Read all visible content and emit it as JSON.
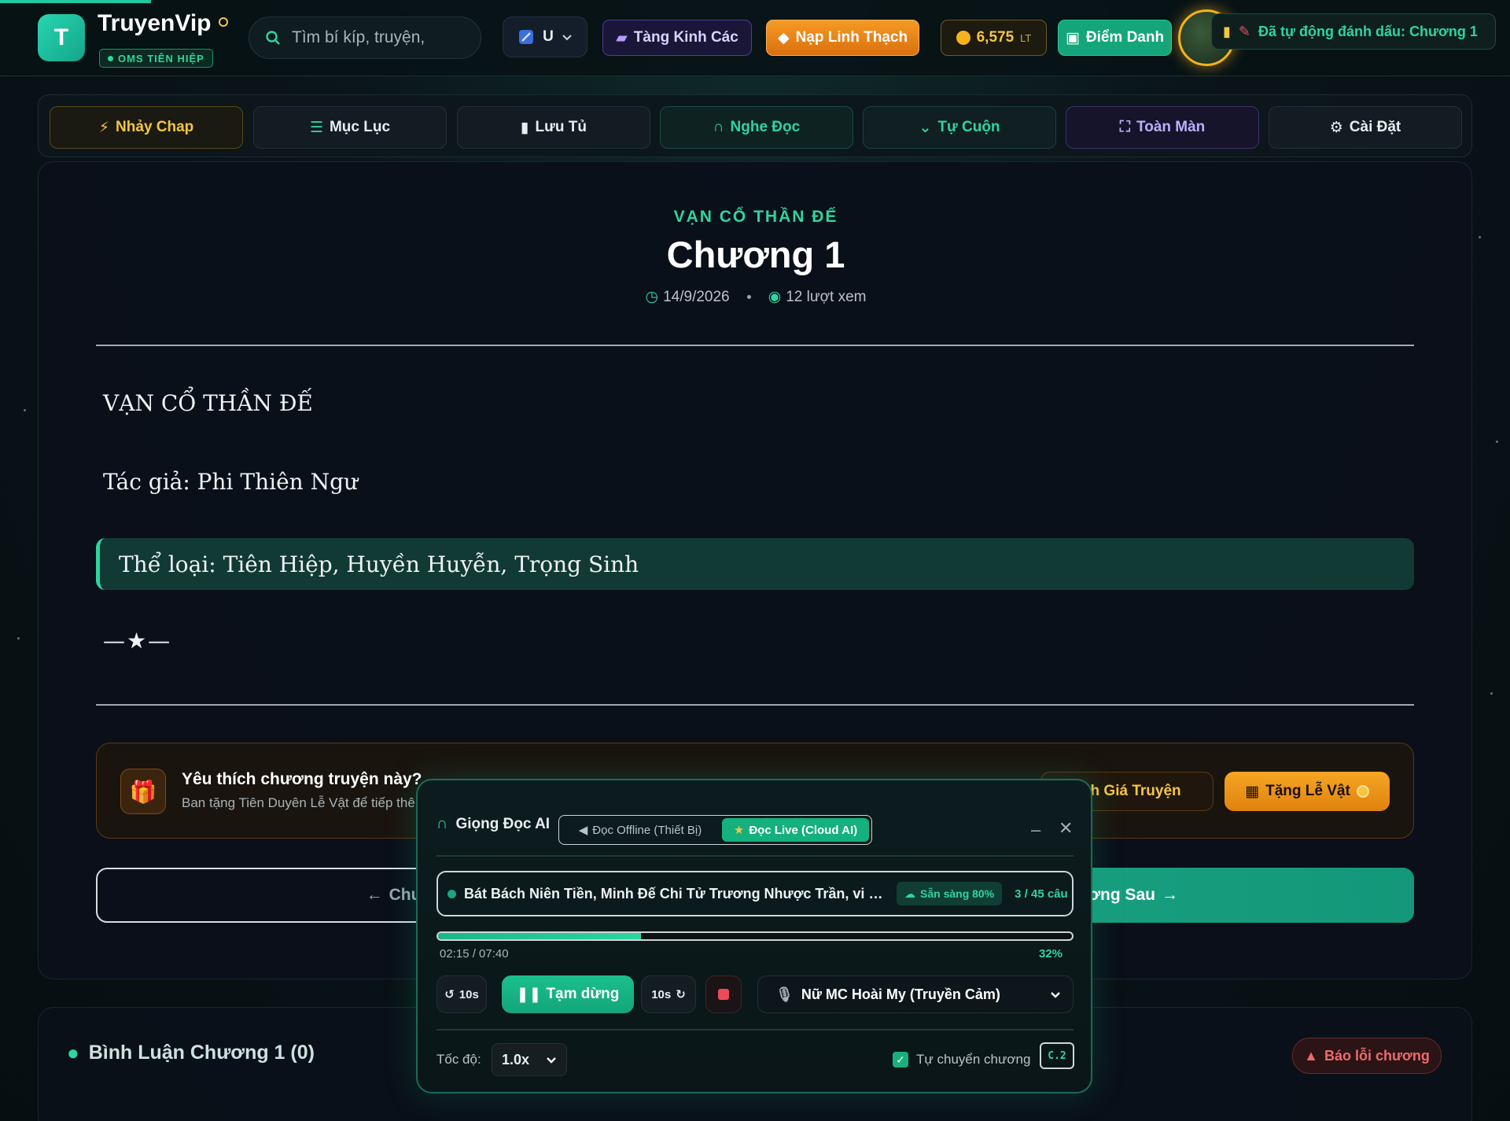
{
  "header": {
    "logo_letter": "T",
    "brand": "TruyenVip",
    "brand_badge": "OMS TIÊN HIỆP",
    "search_placeholder": "Tìm bí kíp, truyện,",
    "user_initial": "U",
    "btn_kinh": "Tàng Kinh Các",
    "btn_nap": "Nạp Linh Thạch",
    "coin_value": "6,575",
    "coin_unit": "LT",
    "btn_diem": "Điểm Danh",
    "toast": "Đã tự động đánh dấu: Chương 1"
  },
  "nav": {
    "jump": "Nhảy Chap",
    "toc": "Mục Lục",
    "save": "Lưu Tủ",
    "listen": "Nghe Đọc",
    "autoscroll": "Tự Cuộn",
    "fullscreen": "Toàn Màn",
    "settings": "Cài Đặt"
  },
  "chapter": {
    "story": "VẠN CỔ THẦN ĐẾ",
    "title": "Chương 1",
    "date": "14/9/2026",
    "views": "12 lượt xem",
    "line1": "VẠN CỔ THẦN ĐẾ",
    "line2": "Tác giả: Phi Thiên Ngư",
    "genre": "Thể loại: Tiên Hiệp, Huyền Huyễn, Trọng Sinh",
    "divider": "—★—"
  },
  "gift": {
    "title": "Yêu thích chương truyện này?",
    "subtitle": "Ban tặng Tiên Duyên Lễ Vật để tiếp thê",
    "rate_label": "ánh Giá Truyện",
    "gift_label": "Tặng Lễ Vật"
  },
  "pager": {
    "prev": "Chương",
    "next": "ơng Sau"
  },
  "comments": {
    "title": "Bình Luận Chương 1 (0)",
    "report": "Báo lỗi chương"
  },
  "tts": {
    "title": "Giọng Đọc AI",
    "mode_offline": "Đọc Offline (Thiết Bị)",
    "mode_live": "Đọc Live (Cloud AI)",
    "sentence": "Bát Bách Niên Tiền, Minh Đế Chi Tử Trương Nhược Trần, vi vị...",
    "ready": "Sẵn sàng 80%",
    "count": "3 / 45 câu",
    "progress": 0.32,
    "time": "02:15 / 07:40",
    "percent": "32%",
    "back_label": "10s",
    "pause_label": "Tạm dừng",
    "fwd_label": "10s",
    "voice": "Nữ MC Hoài My (Truyền Cảm)",
    "speed_label": "Tốc độ:",
    "speed": "1.0x",
    "auto_label": "Tự chuyển chương",
    "auto_checked": true,
    "next_chapter_tag": "C.2"
  },
  "colors": {
    "accent": "#2fd49e",
    "gold": "#f5c542",
    "orange": "#f5a623",
    "danger": "#ef4a5a"
  }
}
